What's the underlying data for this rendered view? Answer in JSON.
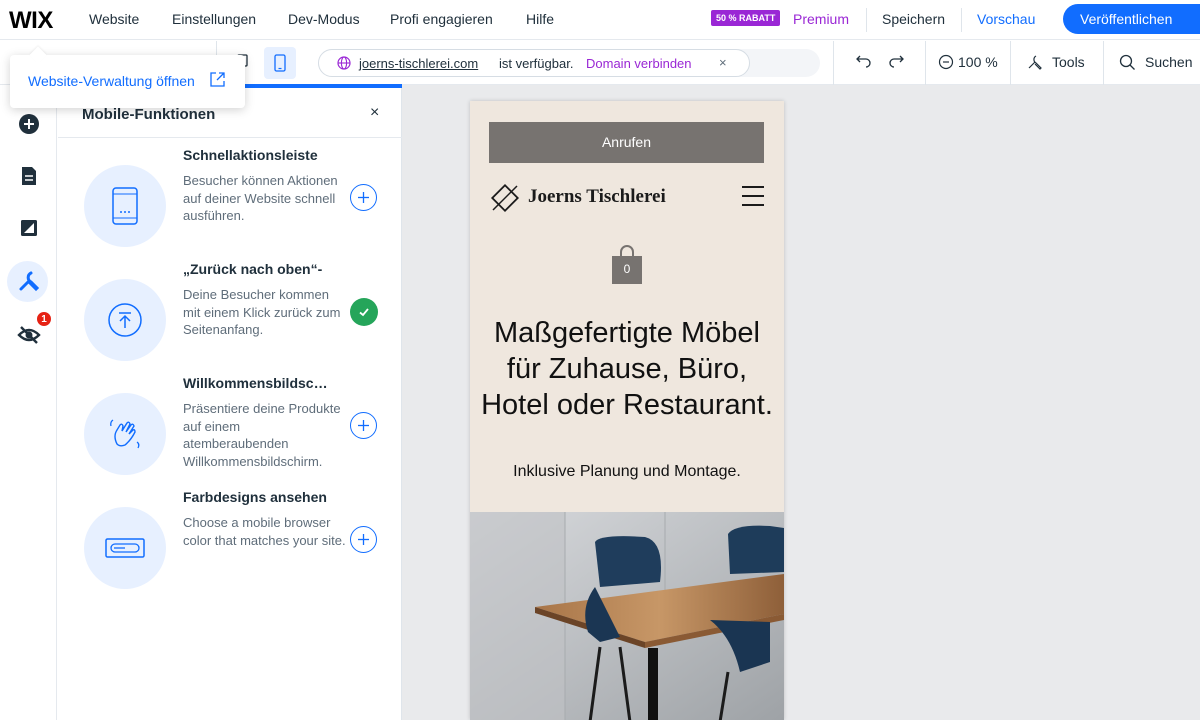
{
  "topbar": {
    "logo": "WIX",
    "menu": [
      "Website",
      "Einstellungen",
      "Dev-Modus",
      "Profi engagieren",
      "Hilfe"
    ],
    "sale_badge": "50 % RABATT",
    "premium": "Premium",
    "save": "Speichern",
    "preview": "Vorschau",
    "publish": "Veröffentlichen"
  },
  "toolbar": {
    "url": "joerns-tischlerei.com",
    "url_suffix": "ist verfügbar.",
    "domain_link": "Domain verbinden",
    "url_close": "×",
    "zoom": "100 %",
    "tools": "Tools",
    "search": "Suchen"
  },
  "tooltip": {
    "text": "Website-Verwaltung öffnen"
  },
  "rail": {
    "badge": "1"
  },
  "panel": {
    "title": "Mobile-Funktionen",
    "close": "×",
    "features": [
      {
        "title": "Schnellaktionsleiste",
        "desc": "Besucher können Aktionen auf deiner Website schnell ausführen.",
        "icon": "phone-icon",
        "state": "add"
      },
      {
        "title": "„Zurück nach oben“-",
        "desc": "Deine Besucher kommen mit einem Klick zurück zum Seitenanfang.",
        "icon": "back-to-top-icon",
        "state": "added"
      },
      {
        "title": "Willkommensbildsc…",
        "desc": "Präsentiere deine Produkte auf einem atemberaubenden Willkommensbildschirm.",
        "icon": "wave-hand-icon",
        "state": "add"
      },
      {
        "title": "Farbdesigns ansehen",
        "desc": "Choose a mobile browser color that matches your site.",
        "icon": "browser-bar-icon",
        "state": "add"
      }
    ]
  },
  "site": {
    "call_button": "Anrufen",
    "brand": "Joerns Tischlerei",
    "cart_count": "0",
    "headline": "Maßgefertigte Möbel für Zuhause, Büro, Hotel oder Restaurant.",
    "subline": "Inklusive Planung und Montage."
  },
  "colors": {
    "accent": "#116dff",
    "premium": "#9a27d5",
    "success": "#25a55a",
    "site_bg": "#efe7de"
  }
}
